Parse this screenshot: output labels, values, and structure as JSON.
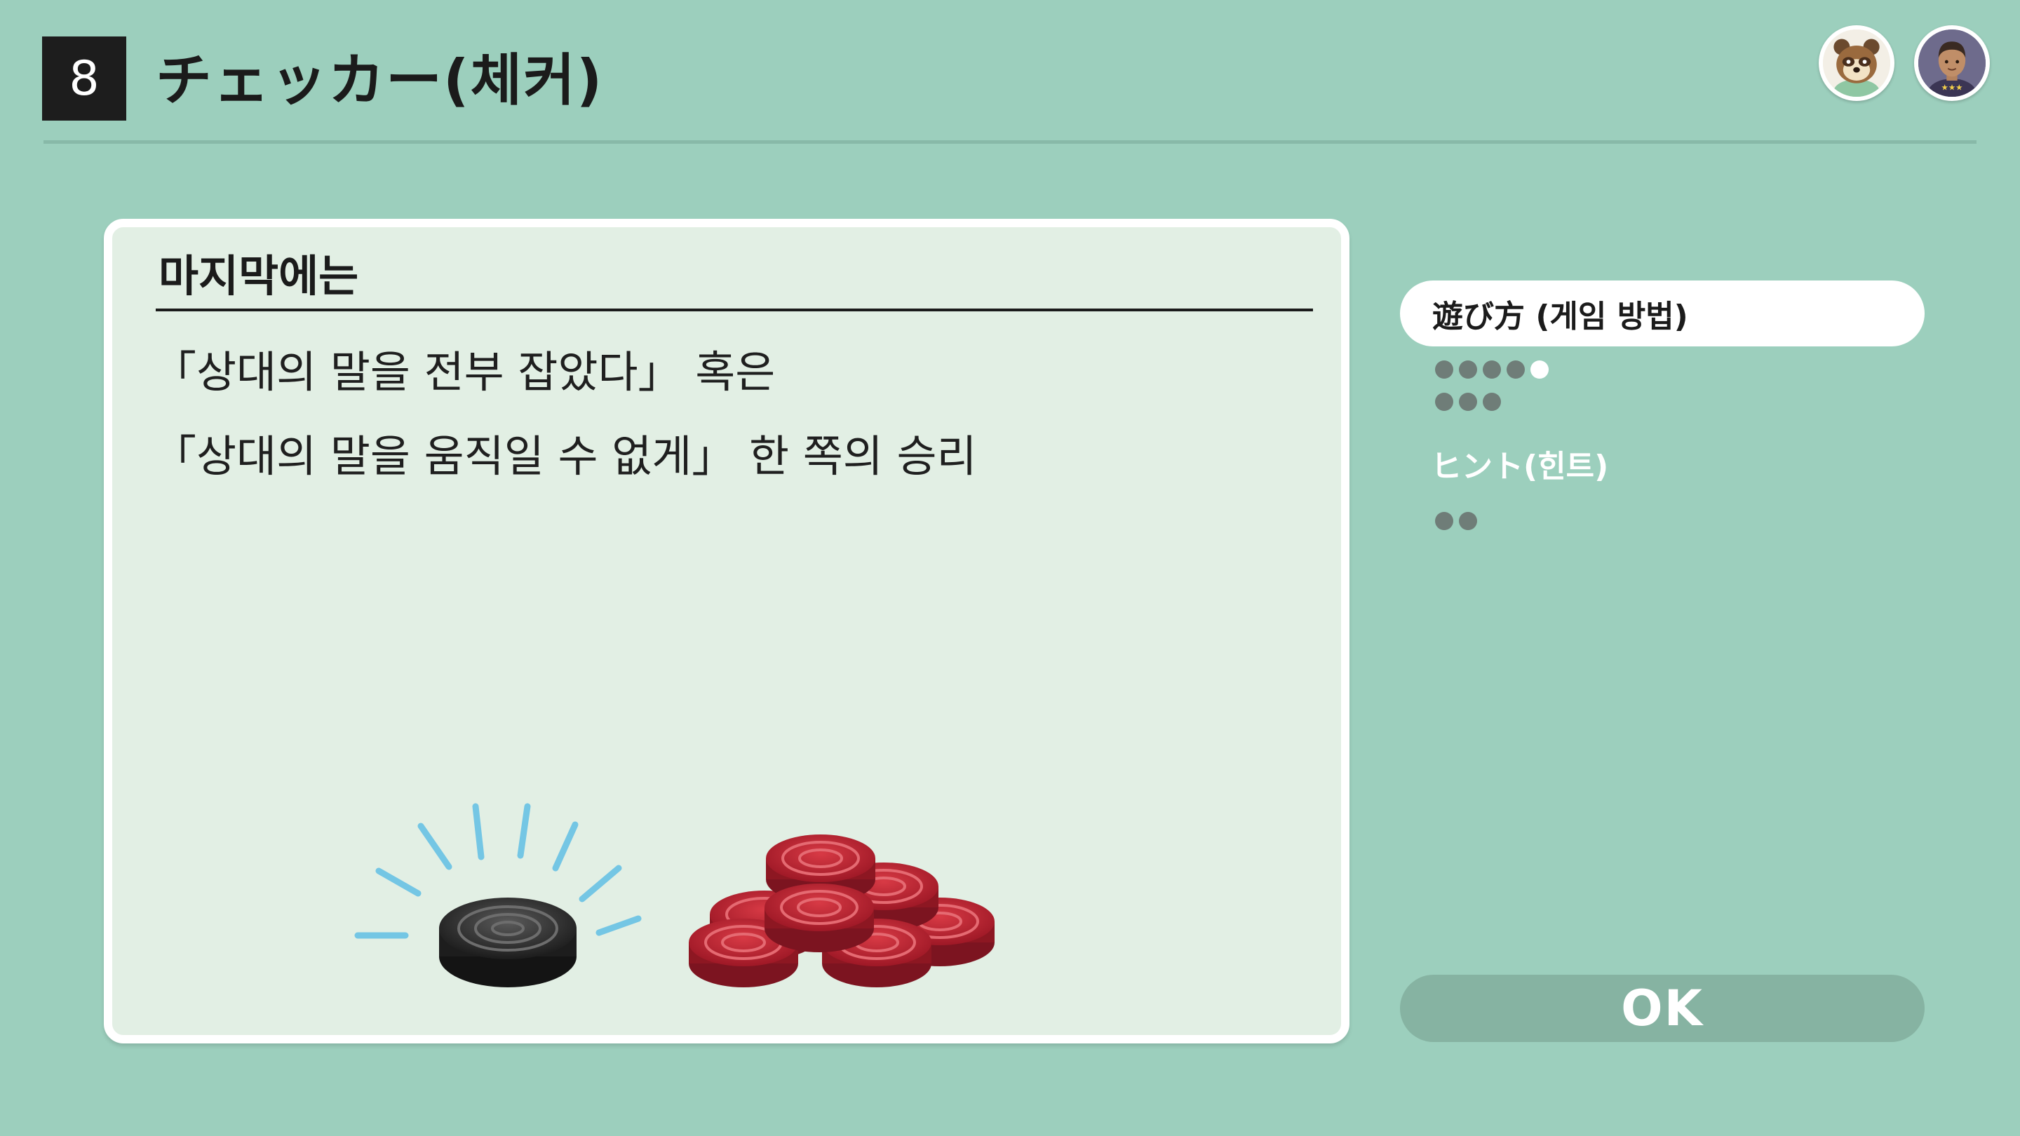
{
  "header": {
    "game_number": "8",
    "title": "チェッカー(체커)"
  },
  "avatars": {
    "npc": "tanuki-avatar-icon",
    "player": "player-avatar-icon"
  },
  "card": {
    "heading": "마지막에는",
    "lines": [
      "「상대의 말을 전부 잡았다」 혹은",
      "「상대의 말을 움직일 수 없게」 한 쪽의 승리"
    ],
    "illustration": "checker-pieces-illustration"
  },
  "sidebar": {
    "howto_label": "遊び方 (게임 방법)",
    "howto_pages": {
      "total": 8,
      "current": 5
    },
    "hint_label": "ヒント(힌트)",
    "hint_pages": {
      "total": 2
    }
  },
  "ok_label": "OK",
  "colors": {
    "background": "#9ccfbd",
    "card": "#e2efe4",
    "black_piece": "#2a2a2a",
    "red_piece": "#b8202f",
    "spark": "#74c6e4"
  }
}
